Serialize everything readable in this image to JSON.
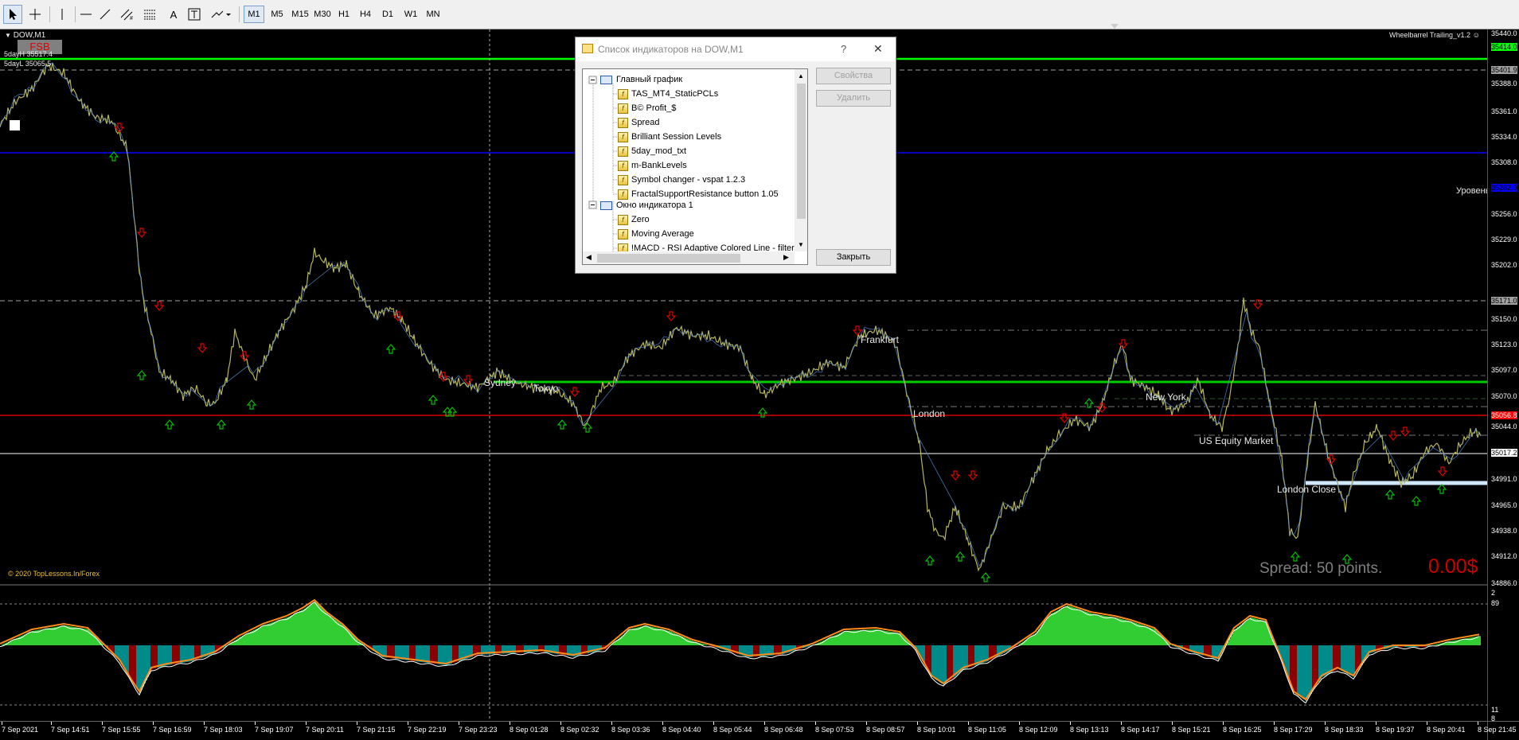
{
  "toolbar": {
    "timeframes": [
      "M1",
      "M5",
      "M15",
      "M30",
      "H1",
      "H4",
      "D1",
      "W1",
      "MN"
    ],
    "active_timeframe": "M1"
  },
  "chart": {
    "symbol": "DOW,M1",
    "fsb_label": "FSB",
    "five_day_high": "5dayH 35517.4",
    "five_day_low": "5dayL 35065.5",
    "expert_name": "Wheelbarrel Trailing_v1.2",
    "level_label": "Уровень",
    "copyright": "© 2020 TopLessons.In/Forex",
    "spread_text": "Spread: 50 points.",
    "profit_text": "0.00$",
    "session_labels": [
      "Sydney",
      "Tokyo",
      "Frankfurt",
      "London",
      "New York",
      "US Equity Market",
      "London Close"
    ],
    "price_labels": [
      "35440.0",
      "35414.0",
      "35401.9",
      "35388.0",
      "35361.0",
      "35334.0",
      "35308.0",
      "35282.0",
      "35256.0",
      "35229.0",
      "35202.0",
      "35171.0",
      "35150.0",
      "35123.0",
      "35097.0",
      "35070.0",
      "35056.8",
      "35044.0",
      "35017.2",
      "34991.0",
      "34965.0",
      "34938.0",
      "34912.0",
      "34886.0"
    ],
    "indicator_scale": [
      "2",
      "89",
      "11",
      "8"
    ],
    "time_labels": [
      "7 Sep 2021",
      "7 Sep 14:51",
      "7 Sep 15:55",
      "7 Sep 16:59",
      "7 Sep 18:03",
      "7 Sep 19:07",
      "7 Sep 20:11",
      "7 Sep 21:15",
      "7 Sep 22:19",
      "7 Sep 23:23",
      "8 Sep 01:28",
      "8 Sep 02:32",
      "8 Sep 03:36",
      "8 Sep 04:40",
      "8 Sep 05:44",
      "8 Sep 06:48",
      "8 Sep 07:53",
      "8 Sep 08:57",
      "8 Sep 10:01",
      "8 Sep 11:05",
      "8 Sep 12:09",
      "8 Sep 13:13",
      "8 Sep 14:17",
      "8 Sep 15:21",
      "8 Sep 16:25",
      "8 Sep 17:29",
      "8 Sep 18:33",
      "8 Sep 19:37",
      "8 Sep 20:41",
      "8 Sep 21:45"
    ],
    "colors": {
      "high_line": "#00ff00",
      "level_blue": "#0000ff",
      "red_line": "#ff0000",
      "histogram_up": "#32cd32",
      "histogram_down": "#008b8b",
      "histogram_red": "#8b0000"
    }
  },
  "dialog": {
    "title": "Список индикаторов на DOW,M1",
    "help": "?",
    "close_x": "✕",
    "main_chart": "Главный график",
    "main_items": [
      "TAS_MT4_StaticPCLs",
      "B© Profit_$",
      "Spread",
      "Brilliant Session Levels",
      "5day_mod_txt",
      "m-BankLevels",
      "Symbol changer - vspat 1.2.3",
      "FractalSupportResistance button 1.05"
    ],
    "window1": "Окно индикатора 1",
    "window_items": [
      "Zero",
      "Moving Average",
      "!MACD - RSI Adaptive Colored Line - filter"
    ],
    "properties_button": "Свойства",
    "delete_button": "Удалить",
    "close_button": "Закрыть"
  }
}
